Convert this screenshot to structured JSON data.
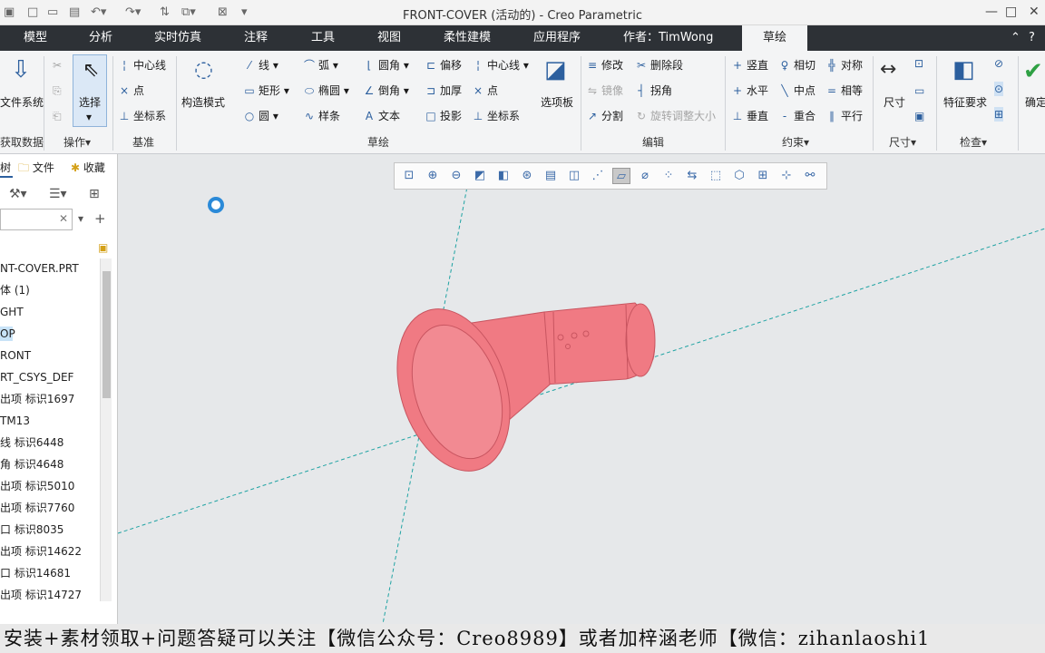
{
  "window": {
    "title": "FRONT-COVER (活动的) - Creo Parametric"
  },
  "menu": {
    "tabs": [
      "模型",
      "分析",
      "实时仿真",
      "注释",
      "工具",
      "视图",
      "柔性建模",
      "应用程序",
      "作者：TimWong",
      "草绘"
    ],
    "active": "草绘"
  },
  "ribbon": {
    "left_big": "文件系统",
    "select": "选择",
    "groups": {
      "getdata": "获取数据",
      "operations": "操作▾",
      "datum": "基准",
      "sketch": "草绘",
      "edit": "编辑",
      "constraint": "约束▾",
      "dimension": "尺寸▾",
      "inspect": "检查▾"
    },
    "datum": [
      "中心线",
      "点",
      "坐标系"
    ],
    "construct": "构造模式",
    "sketch_col1": [
      "线 ▾",
      "矩形 ▾",
      "圆 ▾"
    ],
    "sketch_col2": [
      "弧 ▾",
      "椭圆 ▾",
      "样条"
    ],
    "sketch_col3": [
      "圆角 ▾",
      "倒角 ▾",
      "文本"
    ],
    "sketch_col4": [
      "偏移",
      "加厚",
      "投影"
    ],
    "sketch_col5": [
      "中心线 ▾",
      "点",
      "坐标系"
    ],
    "palette": "选项板",
    "edit_col1": [
      "修改",
      "镜像",
      "分割"
    ],
    "edit_col2": [
      "删除段",
      "拐角",
      "旋转调整大小"
    ],
    "constraint_col1": [
      "竖直",
      "水平",
      "垂直"
    ],
    "constraint_col2": [
      "相切",
      "中点",
      "重合"
    ],
    "constraint_col3": [
      "对称",
      "相等",
      "平行"
    ],
    "dimension": "尺寸",
    "feature_req": "特征要求",
    "ok": "确定"
  },
  "left_panel": {
    "tabs": [
      "树",
      "文件",
      "收藏"
    ],
    "tree": [
      "NT-COVER.PRT",
      "体 (1)",
      "GHT",
      "OP",
      "RONT",
      "RT_CSYS_DEF",
      "出项 标识1697",
      "TM13",
      "线 标识6448",
      "角 标识4648",
      "出项 标识5010",
      "出项 标识7760",
      "口 标识8035",
      "出项 标识14622",
      "口 标识14681",
      "出项 标识14727"
    ],
    "selected_index": 3
  },
  "viewport": {
    "model_color": "#f07a83",
    "background": "#e6e8ea"
  },
  "banner": {
    "text": "安装+素材领取+问题答疑可以关注【微信公众号：Creo8989】或者加梓涵老师【微信：zihanlaoshi1"
  }
}
